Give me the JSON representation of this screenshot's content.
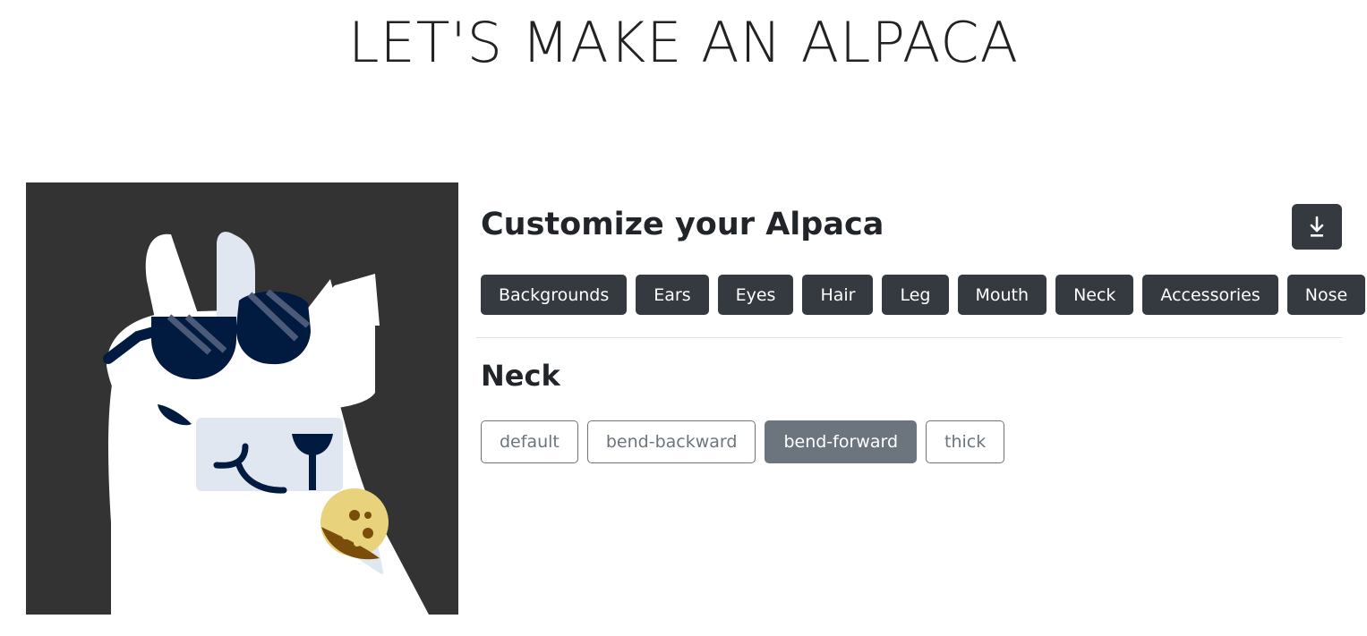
{
  "page": {
    "title": "LET'S MAKE AN ALPACA"
  },
  "panel": {
    "title": "Customize your Alpaca",
    "download_icon": "download-icon",
    "categories": [
      "Backgrounds",
      "Ears",
      "Eyes",
      "Hair",
      "Leg",
      "Mouth",
      "Neck",
      "Accessories",
      "Nose"
    ],
    "section_title": "Neck",
    "options": [
      "default",
      "bend-backward",
      "bend-forward",
      "thick"
    ],
    "selected_option": "bend-forward"
  },
  "colors": {
    "background": "#333333",
    "button_dark": "#343a40",
    "option_secondary": "#6c757d",
    "alpaca_body": "#ffffff",
    "alpaca_face": "#e1e7f0",
    "sunglasses": "#011a40",
    "cookie": "#e8d27c",
    "cookie_dark": "#7a4d0a"
  }
}
